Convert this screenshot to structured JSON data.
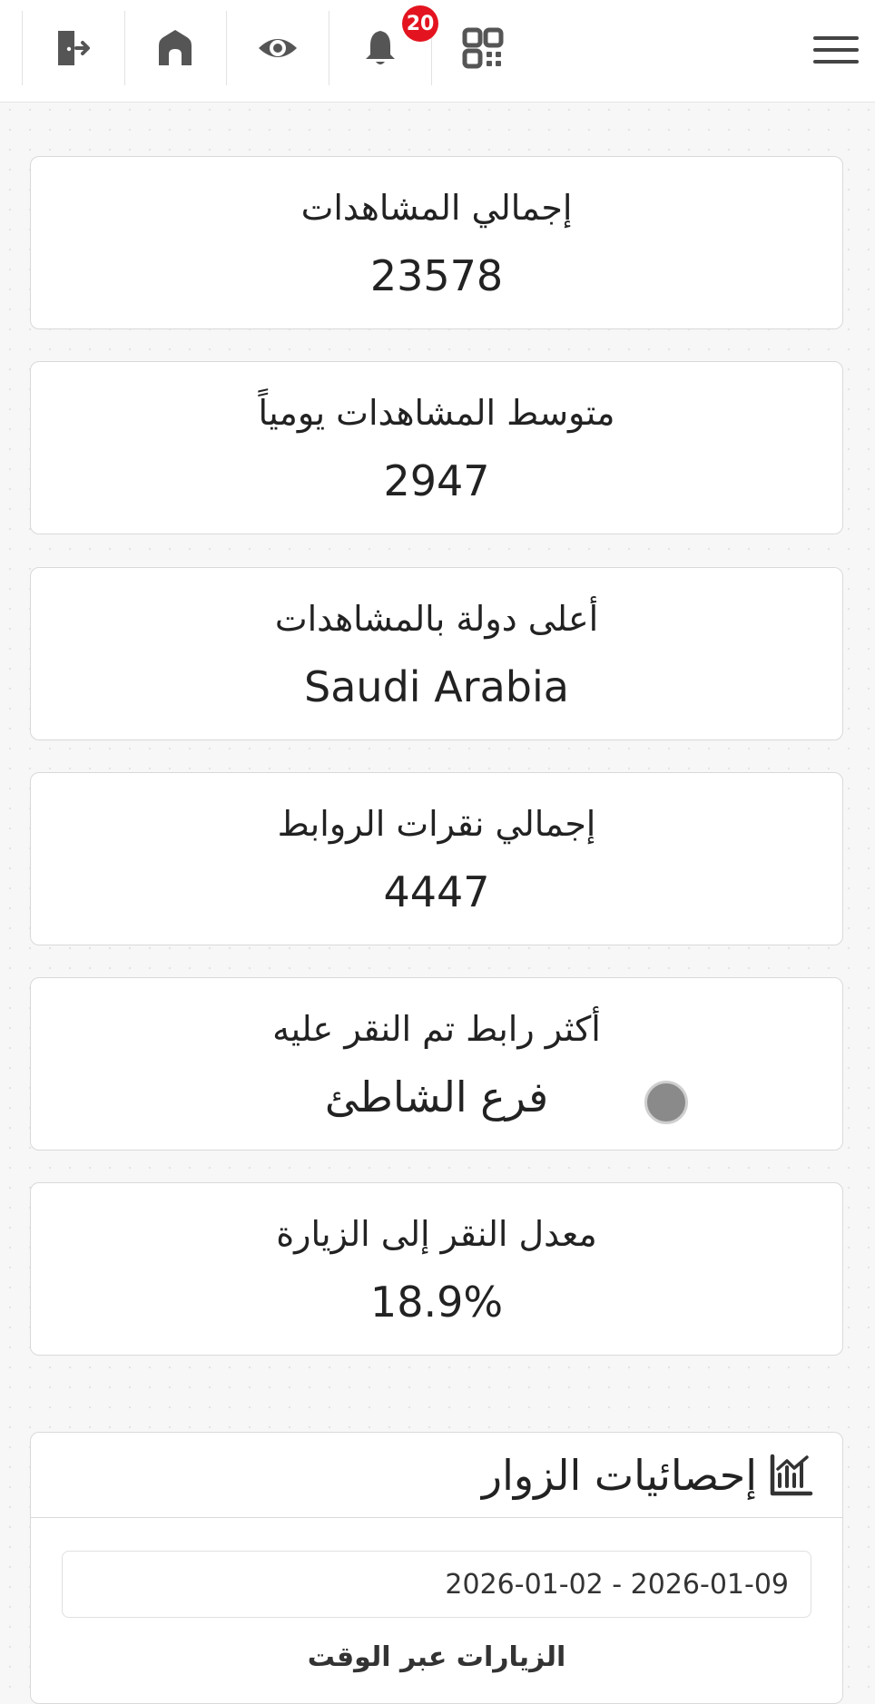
{
  "header": {
    "notification_count": "20",
    "icons": [
      "logout-icon",
      "home-icon",
      "eye-icon",
      "bell-icon",
      "qr-code-icon",
      "menu-icon"
    ]
  },
  "stats": [
    {
      "label": "إجمالي المشاهدات",
      "value": "23578"
    },
    {
      "label": "متوسط المشاهدات يومياً",
      "value": "2947"
    },
    {
      "label": "أعلى دولة بالمشاهدات",
      "value": "Saudi Arabia"
    },
    {
      "label": "إجمالي نقرات الروابط",
      "value": "4447"
    },
    {
      "label": "أكثر رابط تم النقر عليه",
      "value": "فرع الشاطئ"
    },
    {
      "label": "معدل النقر إلى الزيارة",
      "value": "18.9%"
    }
  ],
  "visitor_stats": {
    "title": "إحصائيات الزوار",
    "date_range": "2026-01-02 - 2026-01-09",
    "chart_title": "الزيارات عبر الوقت"
  },
  "colors": {
    "badge": "#e3141f",
    "icon": "#555555",
    "card_border": "#d9d9d9"
  }
}
